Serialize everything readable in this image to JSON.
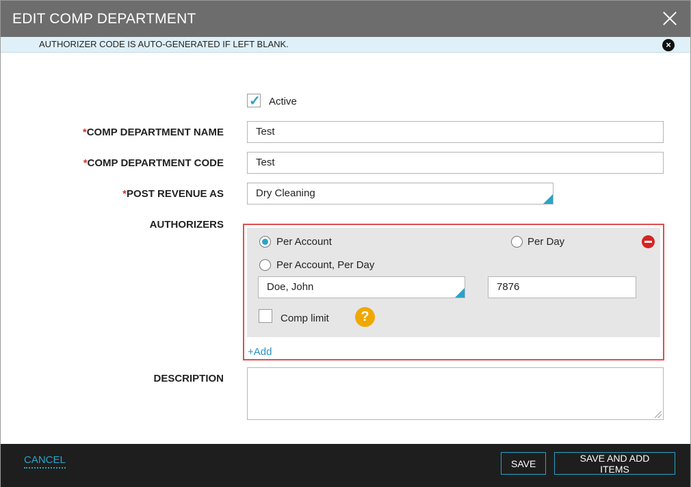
{
  "dialog": {
    "title": "EDIT COMP DEPARTMENT",
    "info_message": "AUTHORIZER CODE IS AUTO-GENERATED IF LEFT BLANK."
  },
  "form": {
    "active_label": "Active",
    "active_checked": true,
    "name_label": "COMP DEPARTMENT NAME",
    "name_value": "Test",
    "code_label": "COMP DEPARTMENT CODE",
    "code_value": "Test",
    "revenue_label": "POST REVENUE AS",
    "revenue_value": "Dry Cleaning",
    "authorizers_label": "AUTHORIZERS",
    "description_label": "DESCRIPTION",
    "required_marker": "*"
  },
  "authorizer": {
    "options": [
      {
        "label": "Per Account",
        "selected": true
      },
      {
        "label": "Per Day",
        "selected": false
      },
      {
        "label": "Per Account, Per Day",
        "selected": false
      }
    ],
    "person_value": "Doe, John",
    "code_value": "7876",
    "comp_limit_label": "Comp limit",
    "comp_limit_checked": false,
    "help_glyph": "?",
    "add_label": "+Add"
  },
  "footer": {
    "cancel_label": "CANCEL",
    "save_label": "SAVE",
    "save_add_label": "SAVE AND ADD ITEMS"
  },
  "colors": {
    "accent": "#2aa3c9",
    "danger": "#d62424",
    "highlight_border": "#e04d4d",
    "help": "#f0a800"
  },
  "icons": {
    "close": "close-icon",
    "info_close": "close-circle-icon",
    "check": "checkmark-icon",
    "remove": "minus-circle-icon",
    "help": "question-circle-icon"
  }
}
